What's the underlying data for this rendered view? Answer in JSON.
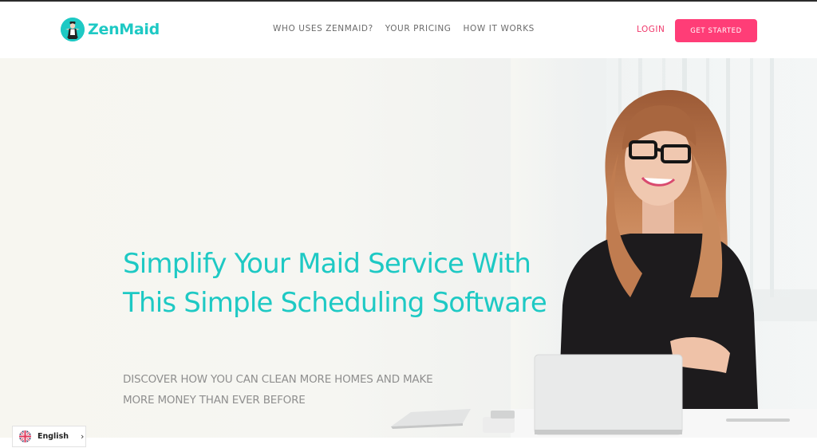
{
  "brand": {
    "name": "ZenMaid",
    "logo_icon": "maid-avatar-icon",
    "accent_color": "#1ec9c4"
  },
  "nav": {
    "items": [
      {
        "label": "WHO USES ZENMAID?"
      },
      {
        "label": "YOUR PRICING"
      },
      {
        "label": "HOW IT WORKS"
      }
    ]
  },
  "header_actions": {
    "login_label": "LOGIN",
    "get_started_label": "GET STARTED",
    "cta_color": "#ff3d77"
  },
  "hero": {
    "headline": "Simplify Your Maid Service With This Simple Scheduling Software",
    "subheadline": "DISCOVER HOW YOU CAN CLEAN MORE HOMES AND MAKE MORE MONEY THAN EVER BEFORE",
    "image_description": "Smiling woman with glasses at desk with laptop"
  },
  "language_switcher": {
    "label": "English",
    "flag_icon": "uk-flag-icon",
    "chevron_icon": "chevron-right-icon"
  }
}
